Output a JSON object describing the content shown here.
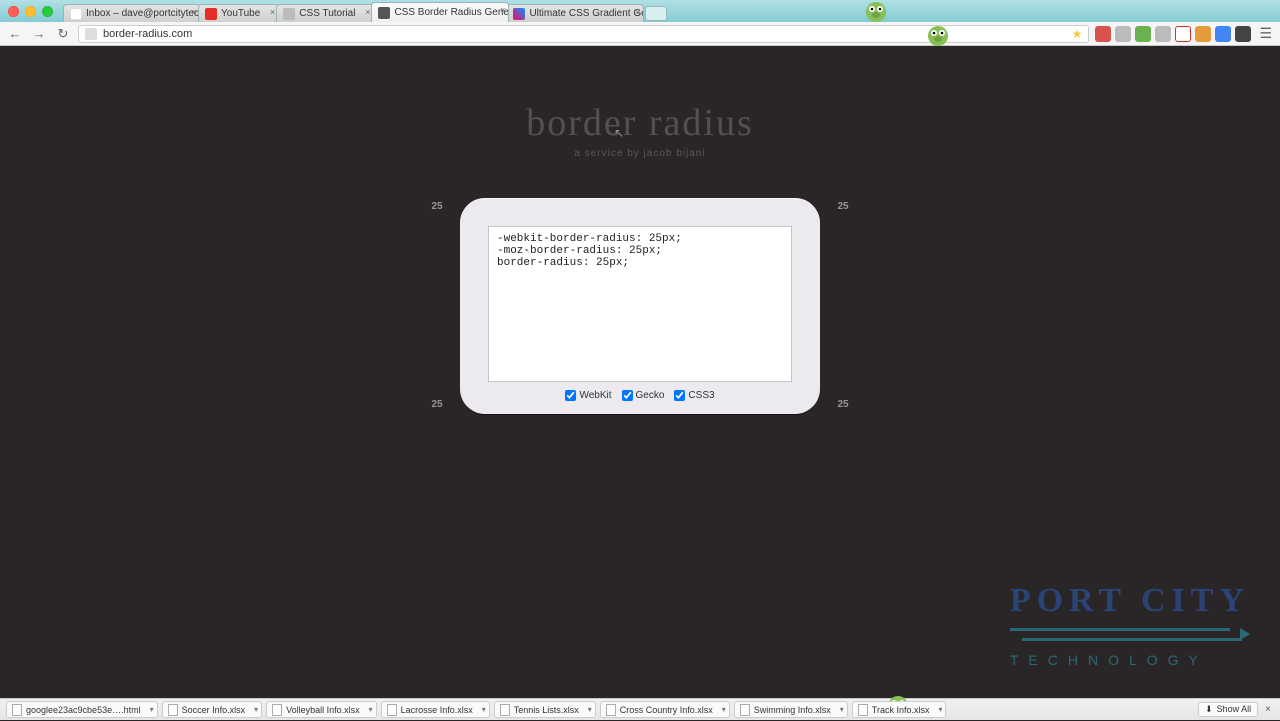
{
  "tabs": [
    {
      "label": "Inbox – dave@portcitytech…",
      "favicon": "gmail",
      "active": false
    },
    {
      "label": "YouTube",
      "favicon": "yt",
      "active": false
    },
    {
      "label": "CSS Tutorial",
      "favicon": "globe",
      "active": false
    },
    {
      "label": "CSS Border Radius Generator",
      "favicon": "active",
      "active": true
    },
    {
      "label": "Ultimate CSS Gradient Gen…",
      "favicon": "grad",
      "active": false
    }
  ],
  "url": "border-radius.com",
  "page": {
    "title": "border radius",
    "subtitle": "a service by jacob bijani",
    "corner_values": {
      "tl": "25",
      "tr": "25",
      "bl": "25",
      "br": "25"
    },
    "code": "-webkit-border-radius: 25px;\n-moz-border-radius: 25px;\nborder-radius: 25px;",
    "options": {
      "webkit": {
        "label": "WebKit",
        "checked": true
      },
      "gecko": {
        "label": "Gecko",
        "checked": true
      },
      "css3": {
        "label": "CSS3",
        "checked": true
      }
    }
  },
  "downloads": [
    "googlee23ac9cbe53e….html",
    "Soccer Info.xlsx",
    "Volleyball Info.xlsx",
    "Lacrosse Info.xlsx",
    "Tennis Lists.xlsx",
    "Cross Country Info.xlsx",
    "Swimming Info.xlsx",
    "Track Info.xlsx"
  ],
  "dl_show_all": "Show All",
  "logo": {
    "line1": "PORT CITY",
    "line2": "TECHNOLOGY"
  }
}
